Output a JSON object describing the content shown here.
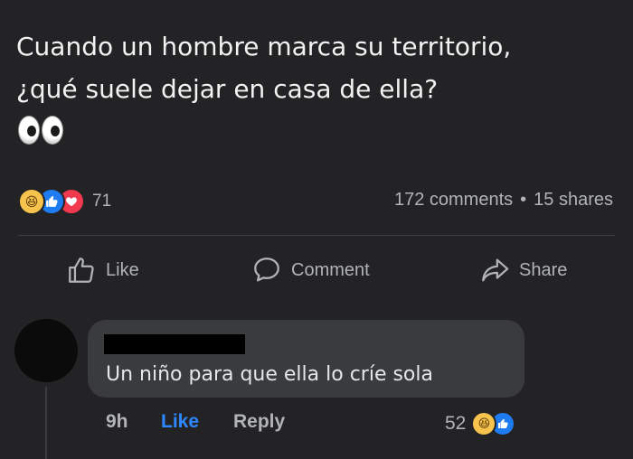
{
  "post": {
    "line1": "Cuando un hombre marca su territorio,",
    "line2": "¿qué suele dejar en casa de ella?",
    "emoji": "eyes"
  },
  "reactions": {
    "icons": [
      "haha-icon",
      "like-icon",
      "love-icon"
    ],
    "count": "71",
    "haha_glyph": "😆",
    "like_glyph": "👍",
    "love_glyph": "♥"
  },
  "stats": {
    "comments": "172 comments",
    "separator": "•",
    "shares": "15 shares"
  },
  "actions": {
    "like": "Like",
    "comment": "Comment",
    "share": "Share"
  },
  "comment": {
    "text": "Un niño para que ella lo críe sola",
    "time": "9h",
    "like": "Like",
    "reply": "Reply",
    "reaction_count": "52"
  },
  "colors": {
    "background": "#232325",
    "bubble": "#3a3b3c",
    "link_blue": "#2d88ff"
  }
}
